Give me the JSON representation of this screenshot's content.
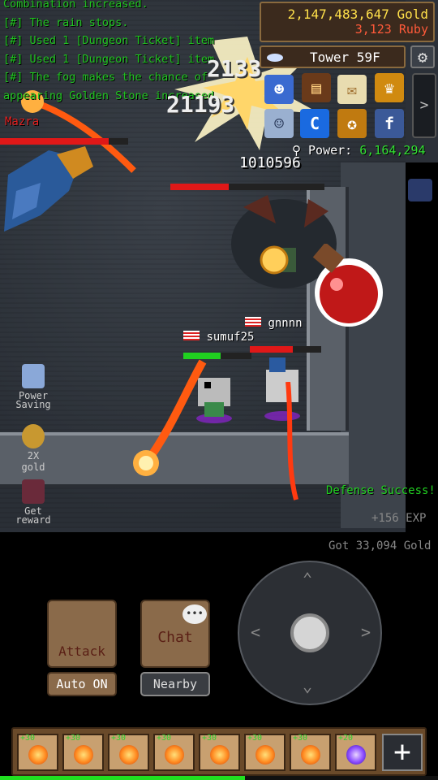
{
  "chat_log": [
    "Combination increased.",
    "[#] The rain stops.",
    "[#] Used 1 [Dungeon Ticket] item",
    "[#] Used 1 [Dungeon Ticket] item",
    "[#] The fog makes the chance of",
    "appearing Golden Stone increased."
  ],
  "currency": {
    "gold": "2,147,483,647 Gold",
    "ruby": "3,123 Ruby"
  },
  "tower": {
    "label": "Tower 59F"
  },
  "power": {
    "label": "Power:",
    "value": "6,164,294"
  },
  "enemy": {
    "name": "Mazra",
    "hp_fraction": 0.85
  },
  "boss": {
    "hp_text": "1010596",
    "hp_fraction": 0.38
  },
  "players": [
    {
      "name": "sumuf25",
      "hp_fraction": 0.55
    },
    {
      "name": "gnnnn",
      "hp_fraction": 0.6
    }
  ],
  "damage_numbers": [
    "2133",
    "21193"
  ],
  "messages": {
    "defense": "Defense Success!",
    "exp": "+156 EXP",
    "got_gold": "Got 33,094 Gold"
  },
  "side_buttons": {
    "power_saving": [
      "Power",
      "Saving"
    ],
    "two_x_gold": "2X gold",
    "get_reward": [
      "Get",
      "reward"
    ]
  },
  "controls": {
    "attack": "Attack",
    "chat": "Chat",
    "auto": "Auto ON",
    "nearby": "Nearby"
  },
  "hotbar": {
    "slots": [
      {
        "level": "+30",
        "type": "fire"
      },
      {
        "level": "+30",
        "type": "fire"
      },
      {
        "level": "+30",
        "type": "fire"
      },
      {
        "level": "+30",
        "type": "fire"
      },
      {
        "level": "+30",
        "type": "fire"
      },
      {
        "level": "+30",
        "type": "fire"
      },
      {
        "level": "+30",
        "type": "fire"
      },
      {
        "level": "+20",
        "type": "purple"
      }
    ],
    "add_label": "+"
  },
  "exp_fraction": 0.56,
  "colors": {
    "chat_green": "#21c521",
    "gold": "#ffe04a",
    "ruby": "#ff5a3a",
    "hp_red": "#e01818",
    "hp_green": "#20d020"
  }
}
